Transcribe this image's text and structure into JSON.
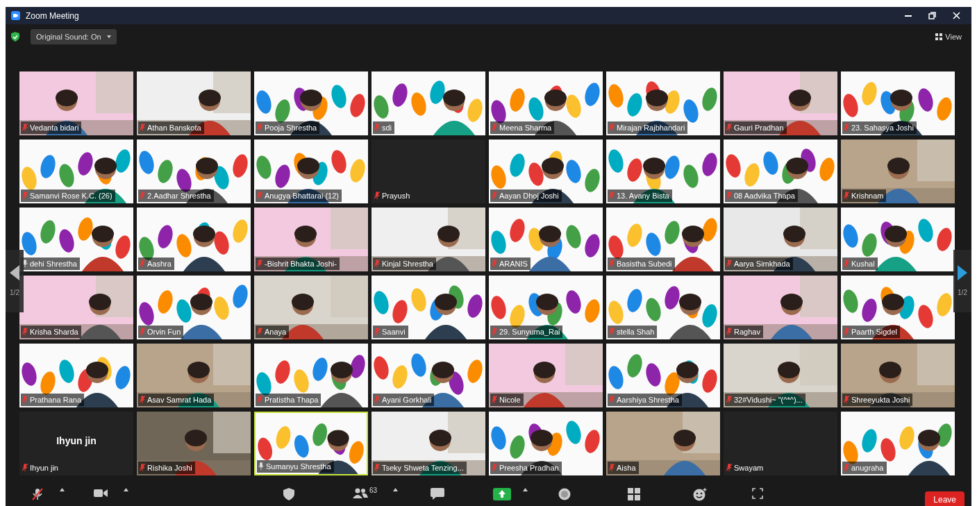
{
  "window": {
    "title": "Zoom Meeting"
  },
  "top_bar": {
    "sound_menu": "Original Sound: On",
    "view_button": "View"
  },
  "pager": {
    "left": "1/2",
    "right": "1/2"
  },
  "tiles": [
    {
      "name": "Vedanta bidari",
      "muted": true,
      "speaking": false
    },
    {
      "name": "Athan Banskota",
      "muted": true,
      "speaking": false
    },
    {
      "name": "Pooja Shrestha",
      "kind": "hands",
      "muted": true,
      "speaking": false
    },
    {
      "name": "sdi",
      "kind": "hands",
      "muted": true,
      "speaking": false
    },
    {
      "name": "Meena Sharma",
      "kind": "hands",
      "muted": true,
      "speaking": false
    },
    {
      "name": "Mirajan Rajbhandari",
      "kind": "hands",
      "muted": true,
      "speaking": false
    },
    {
      "name": "Gauri Pradhan",
      "muted": true,
      "speaking": false
    },
    {
      "name": "23. Sahasya Joshi",
      "kind": "hands",
      "muted": true,
      "speaking": false
    },
    {
      "name": "Samanvi Rose K.C. (26)",
      "kind": "hands",
      "muted": true,
      "speaking": false
    },
    {
      "name": "2.Aadhar Shrestha",
      "kind": "hands",
      "muted": true,
      "speaking": false
    },
    {
      "name": "Anugya Bhattarai (12)",
      "kind": "hands",
      "muted": true,
      "speaking": false
    },
    {
      "name": "Prayush",
      "kind": "blank",
      "muted": true,
      "speaking": false
    },
    {
      "name": "Aayan Dhoj Joshi",
      "kind": "hands",
      "muted": true,
      "speaking": false
    },
    {
      "name": "13. Avany Bista",
      "kind": "hands",
      "muted": true,
      "speaking": false
    },
    {
      "name": "08 Aadvika Thapa",
      "kind": "hands",
      "muted": true,
      "speaking": false
    },
    {
      "name": "Krishnam",
      "muted": true,
      "speaking": false
    },
    {
      "name": "dehi Shrestha",
      "kind": "hands",
      "muted": false,
      "speaking": false
    },
    {
      "name": "Aashra",
      "kind": "hands",
      "muted": true,
      "speaking": false
    },
    {
      "name": "-Bishrit Bhakta Joshi-",
      "muted": true,
      "speaking": false
    },
    {
      "name": "Kinjal Shrestha",
      "muted": true,
      "speaking": false
    },
    {
      "name": "ARANIS",
      "kind": "hands",
      "muted": true,
      "speaking": false
    },
    {
      "name": "Basistha Subedi",
      "kind": "hands",
      "muted": true,
      "speaking": false
    },
    {
      "name": "Aarya Simkhada",
      "muted": true,
      "speaking": false
    },
    {
      "name": "Kushal",
      "kind": "hands",
      "muted": true,
      "speaking": false
    },
    {
      "name": "Krisha Sharda",
      "muted": true,
      "speaking": false
    },
    {
      "name": "Orvin Fun",
      "kind": "hands",
      "muted": true,
      "speaking": false
    },
    {
      "name": "Anaya",
      "muted": true,
      "speaking": false
    },
    {
      "name": "Saanvi",
      "kind": "hands",
      "muted": true,
      "speaking": false
    },
    {
      "name": "29. Sunyuma_Rai",
      "kind": "hands",
      "muted": true,
      "speaking": false
    },
    {
      "name": "stella Shah",
      "kind": "hands",
      "muted": true,
      "speaking": false
    },
    {
      "name": "Raghav",
      "muted": true,
      "speaking": false
    },
    {
      "name": "Paarth Sigdel",
      "kind": "hands",
      "muted": true,
      "speaking": false
    },
    {
      "name": "Prathana Rana",
      "kind": "hands",
      "muted": true,
      "speaking": false
    },
    {
      "name": "Asav Samrat Hada",
      "muted": true,
      "speaking": false
    },
    {
      "name": "Pratistha Thapa",
      "kind": "hands",
      "muted": true,
      "speaking": false
    },
    {
      "name": "Ayani Gorkhali",
      "kind": "hands",
      "muted": true,
      "speaking": false
    },
    {
      "name": "Nicole",
      "muted": true,
      "speaking": false
    },
    {
      "name": "Aarshiya Shrestha",
      "kind": "hands",
      "muted": true,
      "speaking": false
    },
    {
      "name": "32#Vidushi~ \"(^*^)...",
      "muted": true,
      "speaking": false
    },
    {
      "name": "Shreeyukta Joshi",
      "muted": true,
      "speaking": false
    },
    {
      "display_name": "Ihyun jin",
      "name": "Ihyun jin",
      "kind": "name",
      "muted": true,
      "speaking": false
    },
    {
      "name": "Rishika Joshi",
      "muted": true,
      "speaking": false
    },
    {
      "name": "Sumanyu Shrestha",
      "kind": "hands",
      "muted": false,
      "speaking": true
    },
    {
      "name": "Tseky Shweta Tenzing...",
      "muted": true,
      "speaking": false
    },
    {
      "name": "Preesha Pradhan",
      "kind": "hands",
      "muted": true,
      "speaking": false
    },
    {
      "name": "Aisha",
      "muted": true,
      "speaking": false
    },
    {
      "name": "Swayam",
      "kind": "blank",
      "muted": true,
      "speaking": false
    },
    {
      "name": "anugraha",
      "kind": "hands",
      "muted": true,
      "speaking": false
    }
  ],
  "toolbar": {
    "participants_count": "63",
    "leave_button": "Leave"
  }
}
